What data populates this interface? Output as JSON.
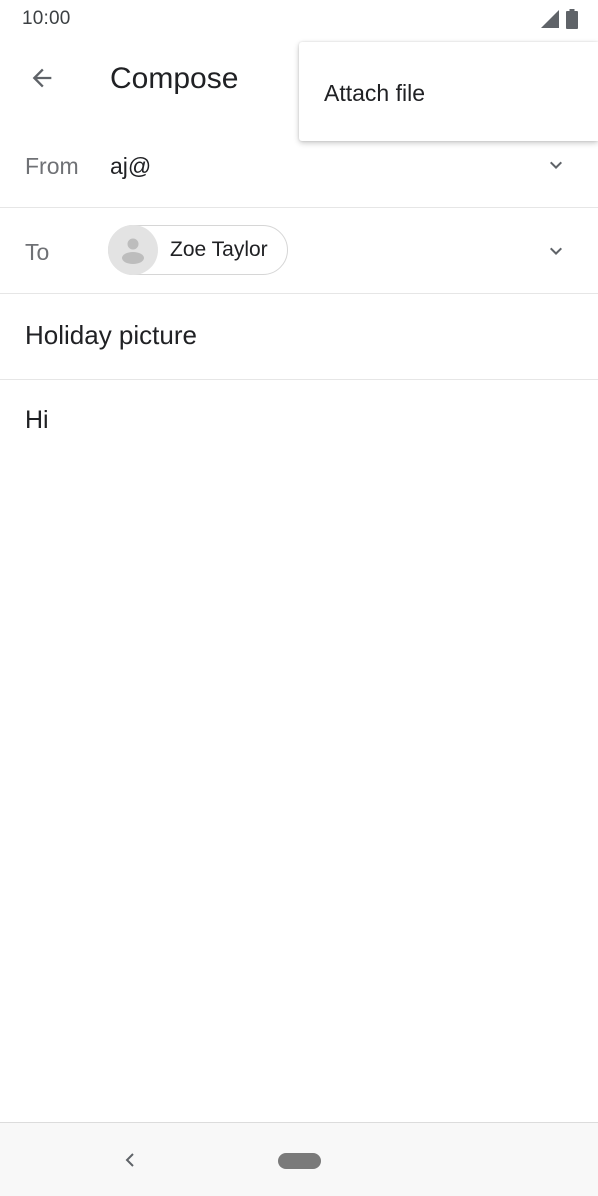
{
  "status_bar": {
    "time": "10:00",
    "icons": [
      "signal-icon",
      "battery-icon"
    ]
  },
  "app_bar": {
    "title": "Compose",
    "back_icon": "arrow-left-icon"
  },
  "overflow_menu": {
    "items": [
      {
        "label": "Attach file"
      }
    ]
  },
  "compose": {
    "from": {
      "label": "From",
      "value": "aj@",
      "expand_icon": "chevron-down-icon"
    },
    "to": {
      "label": "To",
      "recipients": [
        {
          "name": "Zoe Taylor",
          "avatar_icon": "person-icon"
        }
      ],
      "expand_icon": "chevron-down-icon"
    },
    "subject": "Holiday picture",
    "body": "Hi"
  },
  "nav_bar": {
    "back_icon": "nav-back-icon",
    "home_icon": "home-pill-icon"
  },
  "colors": {
    "text_primary": "#202124",
    "text_secondary": "#6f7175",
    "divider": "#e6e6e6",
    "chip_border": "#d6d6d6",
    "avatar_bg": "#e3e3e3",
    "nav_bar_bg": "#f8f8f8"
  }
}
